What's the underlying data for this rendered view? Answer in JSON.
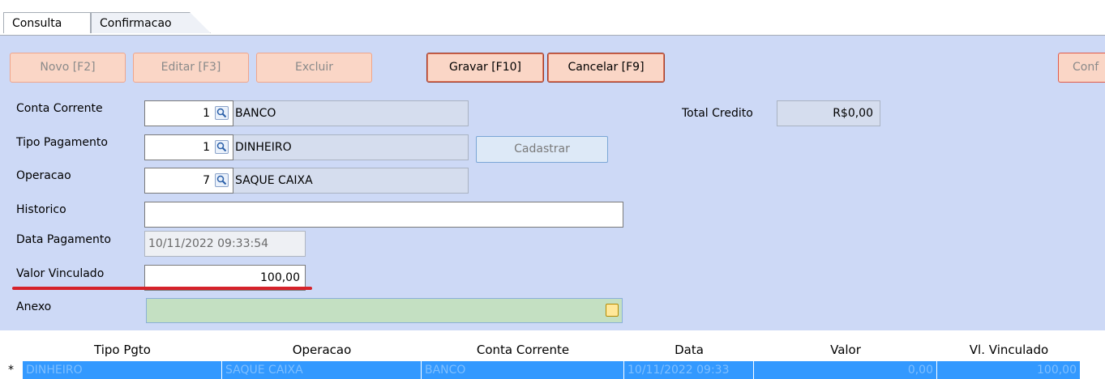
{
  "tabs": [
    {
      "label": "Consulta"
    },
    {
      "label": "Confirmacao"
    }
  ],
  "toolbar": {
    "novo": "Novo [F2]",
    "editar": "Editar [F3]",
    "excluir": "Excluir",
    "gravar": "Gravar [F10]",
    "cancelar": "Cancelar [F9]",
    "confirm_partial": "Conf"
  },
  "form": {
    "conta_corrente": {
      "label": "Conta Corrente",
      "code": "1",
      "name": "BANCO"
    },
    "tipo_pagamento": {
      "label": "Tipo Pagamento",
      "code": "1",
      "name": "DINHEIRO"
    },
    "operacao": {
      "label": "Operacao",
      "code": "7",
      "name": "SAQUE CAIXA"
    },
    "historico": {
      "label": "Historico",
      "value": ""
    },
    "data_pagamento": {
      "label": "Data Pagamento",
      "value": "10/11/2022 09:33:54"
    },
    "valor_vinculado": {
      "label": "Valor Vinculado",
      "value": "100,00"
    },
    "anexo": {
      "label": "Anexo",
      "value": ""
    },
    "cadastrar": "Cadastrar",
    "total_credito": {
      "label": "Total Credito",
      "value": "R$0,00"
    }
  },
  "grid": {
    "headers": [
      "Tipo Pgto",
      "Operacao",
      "Conta Corrente",
      "Data",
      "Valor",
      "Vl. Vinculado"
    ],
    "rows": [
      {
        "marker": "*",
        "tipo": "DINHEIRO",
        "operacao": "SAQUE CAIXA",
        "conta": "BANCO",
        "data": "10/11/2022 09:33",
        "valor": "0,00",
        "vinculado": "100,00"
      }
    ]
  },
  "colors": {
    "panel_bg": "#cdd9f6",
    "button_bg": "#fad6c6",
    "highlight_underline": "#d6222a",
    "row_selected": "#3399ff",
    "anexo_bg": "#c4e0c2"
  },
  "icons": {
    "lookup": "search-icon",
    "attach": "folder-icon"
  }
}
